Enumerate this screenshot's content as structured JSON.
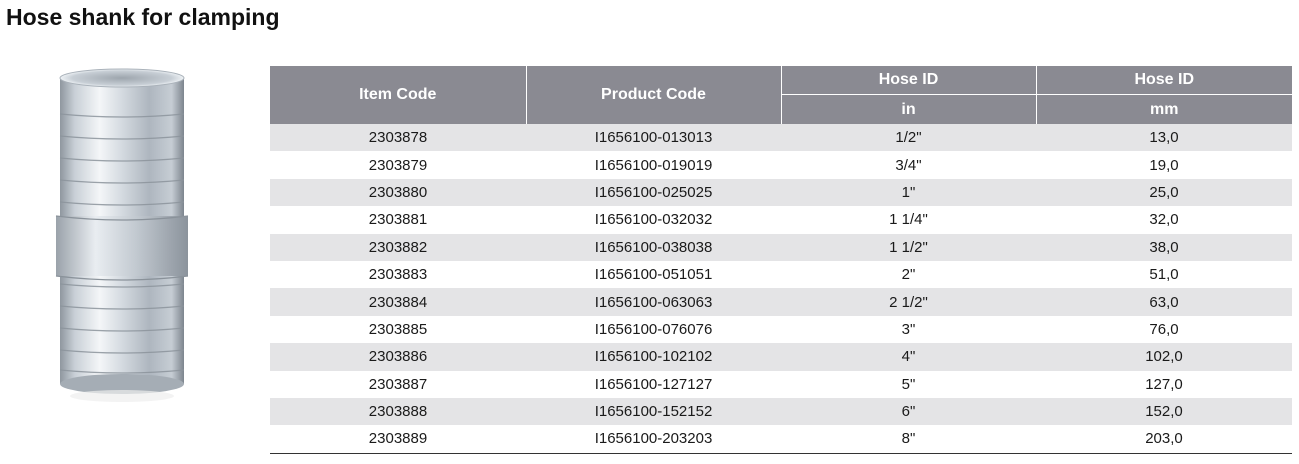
{
  "page": {
    "title": "Hose shank for clamping"
  },
  "image": {
    "icon": "hose-shank-icon",
    "colors": {
      "metal_light": "#eef1f4",
      "metal_mid": "#b9c0c8",
      "metal_dark": "#7f8790"
    }
  },
  "table": {
    "header_color": "#8a8a92",
    "stripe_color": "#e4e4e6",
    "headers": {
      "item_code": "Item Code",
      "product_code": "Product Code",
      "hose_id_in": "Hose ID",
      "hose_id_mm": "Hose ID",
      "unit_in": "in",
      "unit_mm": "mm"
    },
    "rows": [
      {
        "item": "2303878",
        "product": "I1656100-013013",
        "in": "1/2\"",
        "mm": "13,0"
      },
      {
        "item": "2303879",
        "product": "I1656100-019019",
        "in": "3/4\"",
        "mm": "19,0"
      },
      {
        "item": "2303880",
        "product": "I1656100-025025",
        "in": "1\"",
        "mm": "25,0"
      },
      {
        "item": "2303881",
        "product": "I1656100-032032",
        "in": "1 1/4\"",
        "mm": "32,0"
      },
      {
        "item": "2303882",
        "product": "I1656100-038038",
        "in": "1 1/2\"",
        "mm": "38,0"
      },
      {
        "item": "2303883",
        "product": "I1656100-051051",
        "in": "2\"",
        "mm": "51,0"
      },
      {
        "item": "2303884",
        "product": "I1656100-063063",
        "in": "2 1/2\"",
        "mm": "63,0"
      },
      {
        "item": "2303885",
        "product": "I1656100-076076",
        "in": "3\"",
        "mm": "76,0"
      },
      {
        "item": "2303886",
        "product": "I1656100-102102",
        "in": "4\"",
        "mm": "102,0"
      },
      {
        "item": "2303887",
        "product": "I1656100-127127",
        "in": "5\"",
        "mm": "127,0"
      },
      {
        "item": "2303888",
        "product": "I1656100-152152",
        "in": "6\"",
        "mm": "152,0"
      },
      {
        "item": "2303889",
        "product": "I1656100-203203",
        "in": "8\"",
        "mm": "203,0"
      }
    ]
  }
}
